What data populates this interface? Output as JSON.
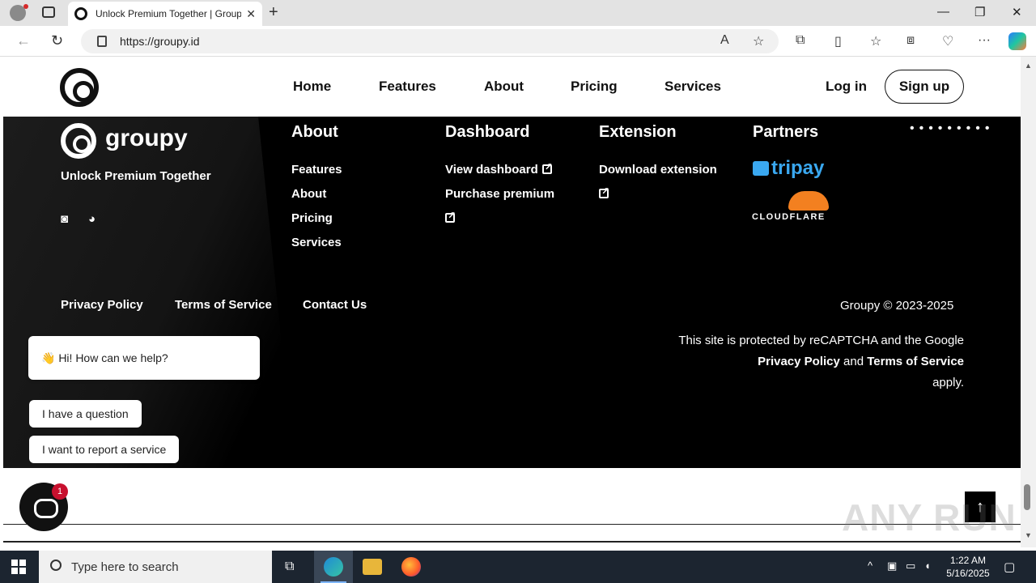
{
  "browser": {
    "tab_title": "Unlock Premium Together | Groupy",
    "url": "https://groupy.id",
    "new_tab_label": "+",
    "close_label": "✕",
    "minimize_label": "—",
    "restore_label": "❐"
  },
  "header": {
    "nav": [
      "Home",
      "Features",
      "About",
      "Pricing",
      "Services"
    ],
    "login": "Log in",
    "signup": "Sign up"
  },
  "footer": {
    "brand": "groupy",
    "tagline": "Unlock Premium Together",
    "columns": {
      "about": {
        "heading": "About",
        "links": [
          "Features",
          "About",
          "Pricing",
          "Services"
        ]
      },
      "dashboard": {
        "heading": "Dashboard",
        "links": [
          "View dashboard",
          "Purchase premium"
        ]
      },
      "extension": {
        "heading": "Extension",
        "links": [
          "Download extension"
        ]
      },
      "partners": {
        "heading": "Partners",
        "logos": [
          "tripay",
          "CLOUDFLARE"
        ]
      }
    },
    "legal": [
      "Privacy Policy",
      "Terms of Service",
      "Contact Us"
    ],
    "copyright": "Groupy © 2023-2025",
    "recaptcha": {
      "prefix": "This site is protected by reCAPTCHA and the Google",
      "privacy": "Privacy Policy",
      "and": "and",
      "terms": "Terms of Service",
      "suffix": "apply."
    }
  },
  "chat": {
    "greeting": "👋 Hi! How can we help?",
    "options": [
      "I have a question",
      "I want to report a service"
    ],
    "badge": "1"
  },
  "watermark": "ANY RUN",
  "taskbar": {
    "search_placeholder": "Type here to search",
    "time": "1:22 AM",
    "date": "5/16/2025"
  },
  "colors": {
    "footer_bg": "#000000",
    "tripay": "#3aa8f0",
    "cloudflare": "#f38020",
    "chat_badge": "#c8102e"
  }
}
